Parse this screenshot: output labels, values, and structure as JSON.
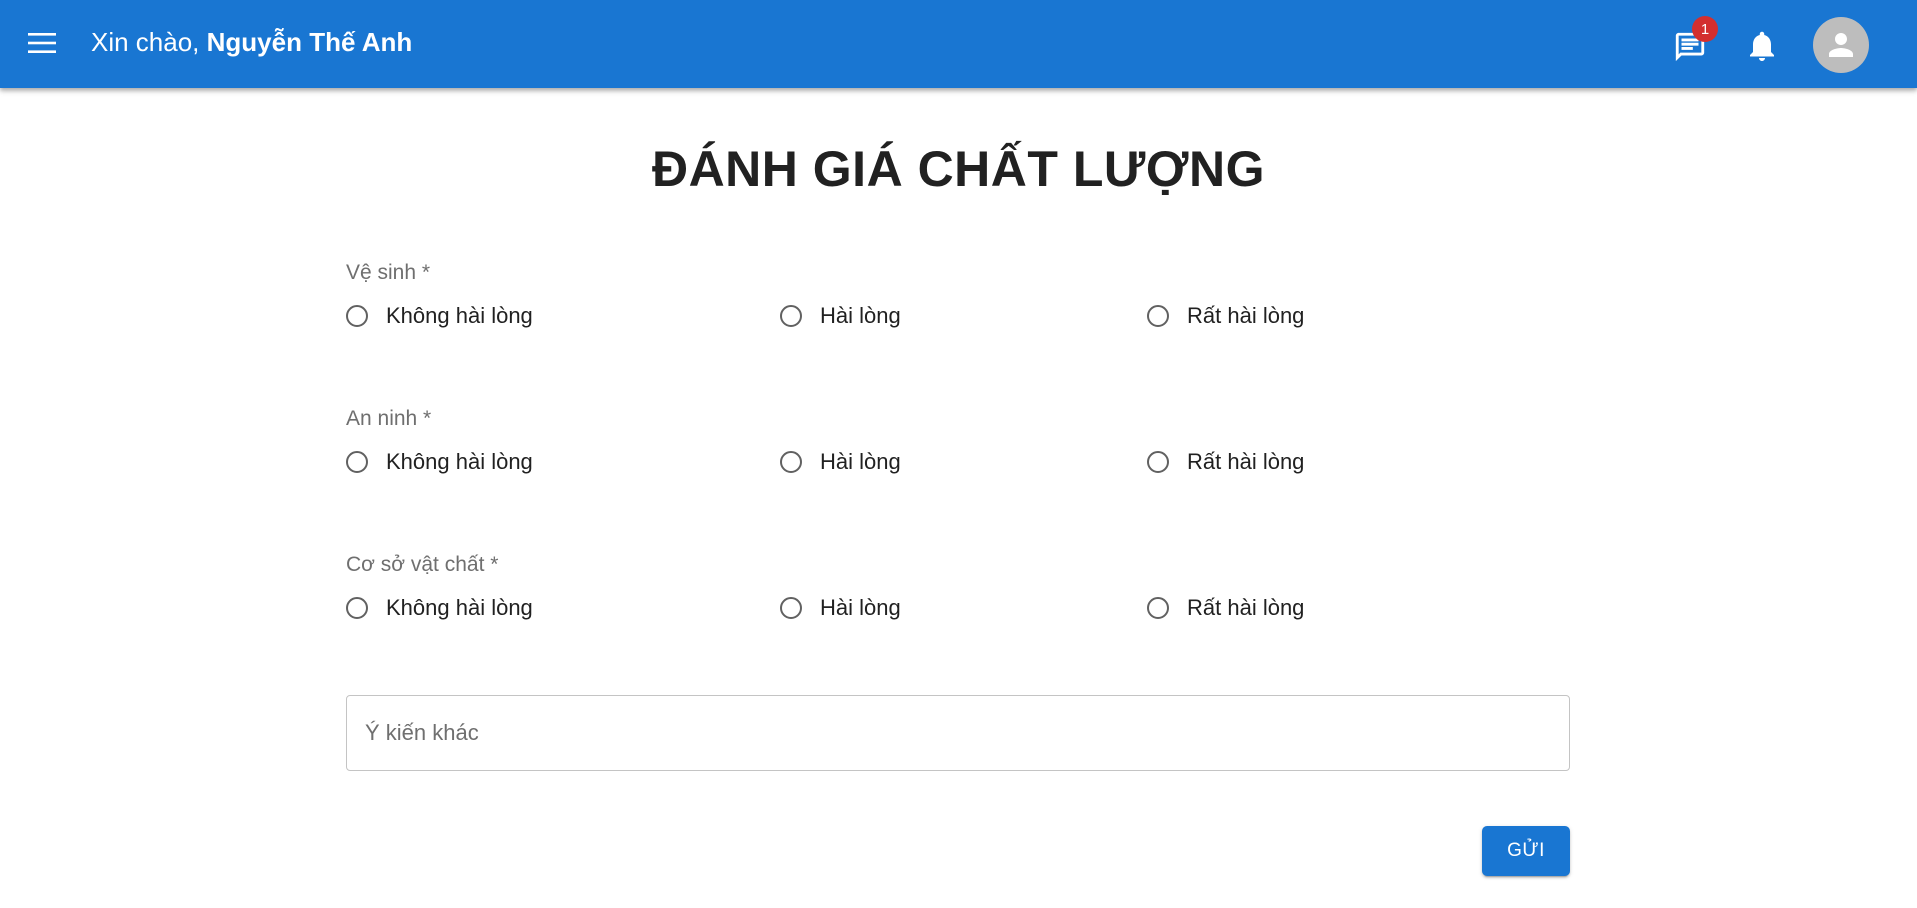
{
  "header": {
    "greeting_prefix": "Xin chào,",
    "user_name": "Nguyễn Thế Anh",
    "messages_badge": "1",
    "icons": {
      "menu": "menu-icon",
      "messages": "chat-icon",
      "notifications": "bell-icon",
      "account": "account-avatar-icon"
    },
    "background_color": "#1976d2"
  },
  "page": {
    "title": "ĐÁNH GIÁ CHẤT LƯỢNG"
  },
  "form": {
    "questions": [
      {
        "label": "Vệ sinh *",
        "options": [
          "Không hài lòng",
          "Hài lòng",
          "Rất hài lòng"
        ]
      },
      {
        "label": "An ninh *",
        "options": [
          "Không hài lòng",
          "Hài lòng",
          "Rất hài lòng"
        ]
      },
      {
        "label": "Cơ sở vật chất *",
        "options": [
          "Không hài lòng",
          "Hài lòng",
          "Rất hài lòng"
        ]
      }
    ],
    "comment": {
      "placeholder": "Ý kiến khác",
      "value": ""
    },
    "submit_label": "GỬI"
  },
  "colors": {
    "primary": "#1976d2",
    "badge": "#d32f2f",
    "avatar_bg": "#bdbdbd"
  }
}
